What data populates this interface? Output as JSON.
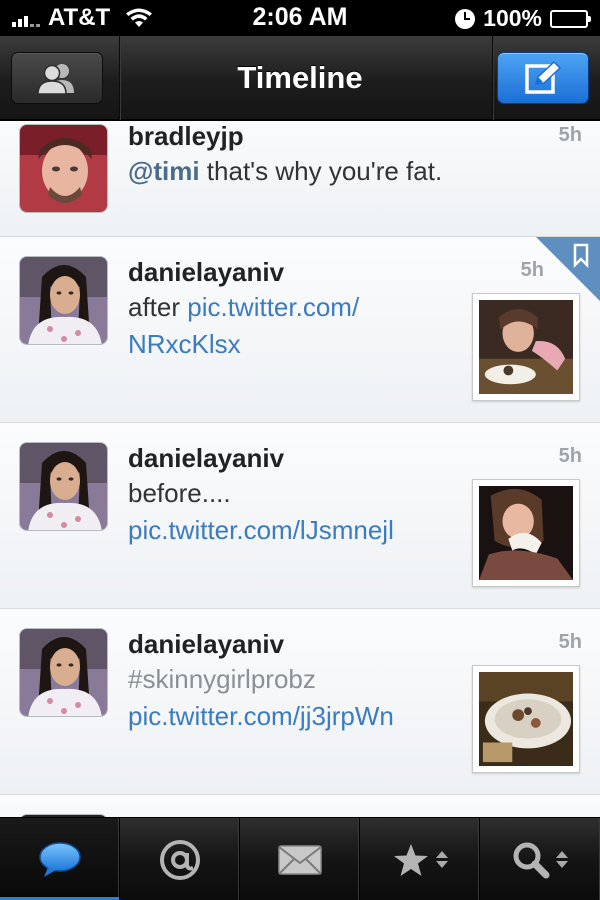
{
  "status_bar": {
    "carrier": "AT&T",
    "time": "2:06 AM",
    "battery": "100%",
    "signal_icon": "signal-bars-icon",
    "wifi_icon": "wifi-icon",
    "alarm_icon": "clock-icon",
    "battery_icon": "battery-icon"
  },
  "nav": {
    "title": "Timeline",
    "left_button_icon": "accounts-icon",
    "right_button_icon": "compose-icon",
    "compose_color": "#2a85e8"
  },
  "timeline": {
    "tweets": [
      {
        "author": "bradleyjp",
        "time": "5h",
        "parts": {
          "mention": "@timi",
          "text": " that's why you're fat."
        }
      },
      {
        "author": "danielayaniv",
        "time": "5h",
        "favorited": true,
        "parts": {
          "text": "after ",
          "link": "pic.twitter.com/NRxcKlsx",
          "link_line1": "pic.twitter.com/",
          "link_line2": "NRxcKlsx"
        }
      },
      {
        "author": "danielayaniv",
        "time": "5h",
        "parts": {
          "text": "before....",
          "link": "pic.twitter.com/lJsmnejl"
        }
      },
      {
        "author": "danielayaniv",
        "time": "5h",
        "parts": {
          "hashtag": "#skinnygirlprobz",
          "link": "pic.twitter.com/jj3jrpWn"
        }
      }
    ],
    "link_color": "#3b7bbf",
    "favorite_corner_color": "#5f8fbf"
  },
  "tab_bar": {
    "tabs": [
      {
        "icon": "chat-bubble-icon",
        "active": true
      },
      {
        "icon": "at-sign-icon",
        "active": false
      },
      {
        "icon": "envelope-icon",
        "active": false
      },
      {
        "icon": "star-icon",
        "active": false
      },
      {
        "icon": "search-icon",
        "active": false
      }
    ],
    "active_color": "#2a7fd6"
  }
}
